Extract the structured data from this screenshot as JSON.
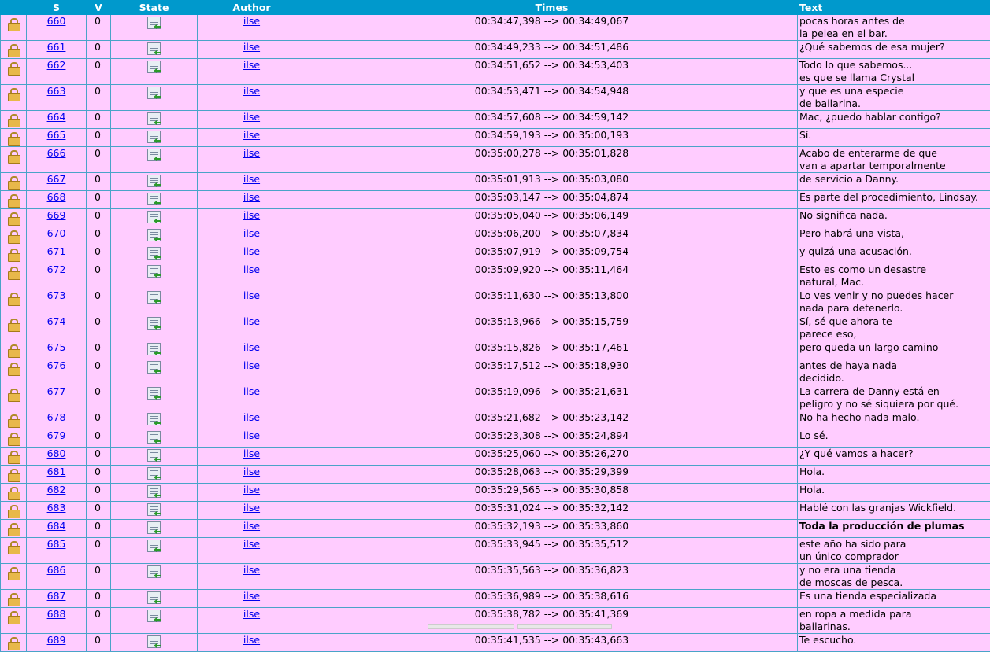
{
  "headers": {
    "s": "S",
    "v": "V",
    "state": "State",
    "author": "Author",
    "times": "Times",
    "text": "Text"
  },
  "icons": {
    "row_lock": "lock-icon",
    "row_state": "state-icon"
  },
  "colors": {
    "header_bg": "#0099cc",
    "row_bg": "#ffccff",
    "link": "#0000ee"
  },
  "rows": [
    {
      "s": "660",
      "v": "0",
      "author": "ilse",
      "times": "00:34:47,398 --> 00:34:49,067",
      "text": "pocas horas antes de\nla pelea en el bar."
    },
    {
      "s": "661",
      "v": "0",
      "author": "ilse",
      "times": "00:34:49,233 --> 00:34:51,486",
      "text": "¿Qué sabemos de esa mujer?"
    },
    {
      "s": "662",
      "v": "0",
      "author": "ilse",
      "times": "00:34:51,652 --> 00:34:53,403",
      "text": "Todo lo que sabemos...\nes que se llama Crystal"
    },
    {
      "s": "663",
      "v": "0",
      "author": "ilse",
      "times": "00:34:53,471 --> 00:34:54,948",
      "text": "y que es una especie\nde bailarina."
    },
    {
      "s": "664",
      "v": "0",
      "author": "ilse",
      "times": "00:34:57,608 --> 00:34:59,142",
      "text": "Mac, ¿puedo hablar contigo?"
    },
    {
      "s": "665",
      "v": "0",
      "author": "ilse",
      "times": "00:34:59,193 --> 00:35:00,193",
      "text": "Sí."
    },
    {
      "s": "666",
      "v": "0",
      "author": "ilse",
      "times": "00:35:00,278 --> 00:35:01,828",
      "text": "Acabo de enterarme de que\nvan a apartar temporalmente"
    },
    {
      "s": "667",
      "v": "0",
      "author": "ilse",
      "times": "00:35:01,913 --> 00:35:03,080",
      "text": "de servicio a Danny."
    },
    {
      "s": "668",
      "v": "0",
      "author": "ilse",
      "times": "00:35:03,147 --> 00:35:04,874",
      "text": "Es parte del procedimiento, Lindsay."
    },
    {
      "s": "669",
      "v": "0",
      "author": "ilse",
      "times": "00:35:05,040 --> 00:35:06,149",
      "text": "No significa nada."
    },
    {
      "s": "670",
      "v": "0",
      "author": "ilse",
      "times": "00:35:06,200 --> 00:35:07,834",
      "text": "Pero habrá una vista,"
    },
    {
      "s": "671",
      "v": "0",
      "author": "ilse",
      "times": "00:35:07,919 --> 00:35:09,754",
      "text": "y quizá una acusación."
    },
    {
      "s": "672",
      "v": "0",
      "author": "ilse",
      "times": "00:35:09,920 --> 00:35:11,464",
      "text": "Esto es como un desastre\nnatural, Mac."
    },
    {
      "s": "673",
      "v": "0",
      "author": "ilse",
      "times": "00:35:11,630 --> 00:35:13,800",
      "text": "Lo ves venir y no puedes hacer\nnada para detenerlo."
    },
    {
      "s": "674",
      "v": "0",
      "author": "ilse",
      "times": "00:35:13,966 --> 00:35:15,759",
      "text": "Sí, sé que ahora te\nparece eso,"
    },
    {
      "s": "675",
      "v": "0",
      "author": "ilse",
      "times": "00:35:15,826 --> 00:35:17,461",
      "text": "pero queda un largo camino"
    },
    {
      "s": "676",
      "v": "0",
      "author": "ilse",
      "times": "00:35:17,512 --> 00:35:18,930",
      "text": "antes de haya nada\ndecidido."
    },
    {
      "s": "677",
      "v": "0",
      "author": "ilse",
      "times": "00:35:19,096 --> 00:35:21,631",
      "text": "La carrera de Danny está en\npeligro y no sé siquiera por qué."
    },
    {
      "s": "678",
      "v": "0",
      "author": "ilse",
      "times": "00:35:21,682 --> 00:35:23,142",
      "text": "No ha hecho nada malo."
    },
    {
      "s": "679",
      "v": "0",
      "author": "ilse",
      "times": "00:35:23,308 --> 00:35:24,894",
      "text": "Lo sé."
    },
    {
      "s": "680",
      "v": "0",
      "author": "ilse",
      "times": "00:35:25,060 --> 00:35:26,270",
      "text": "¿Y qué vamos a hacer?"
    },
    {
      "s": "681",
      "v": "0",
      "author": "ilse",
      "times": "00:35:28,063 --> 00:35:29,399",
      "text": "Hola."
    },
    {
      "s": "682",
      "v": "0",
      "author": "ilse",
      "times": "00:35:29,565 --> 00:35:30,858",
      "text": "Hola."
    },
    {
      "s": "683",
      "v": "0",
      "author": "ilse",
      "times": "00:35:31,024 --> 00:35:32,142",
      "text": "Hablé con las granjas Wickfield."
    },
    {
      "s": "684",
      "v": "0",
      "author": "ilse",
      "times": "00:35:32,193 --> 00:35:33,860",
      "text": "Toda la producción de plumas",
      "bold": true
    },
    {
      "s": "685",
      "v": "0",
      "author": "ilse",
      "times": "00:35:33,945 --> 00:35:35,512",
      "text": "este año ha sido para\nun único comprador"
    },
    {
      "s": "686",
      "v": "0",
      "author": "ilse",
      "times": "00:35:35,563 --> 00:35:36,823",
      "text": "y no era una tienda\nde moscas de pesca."
    },
    {
      "s": "687",
      "v": "0",
      "author": "ilse",
      "times": "00:35:36,989 --> 00:35:38,616",
      "text": "Es una tienda especializada"
    },
    {
      "s": "688",
      "v": "0",
      "author": "ilse",
      "times": "00:35:38,782 --> 00:35:41,369",
      "text": "en ropa a medida para\nbailarinas."
    },
    {
      "s": "689",
      "v": "0",
      "author": "ilse",
      "times": "00:35:41,535 --> 00:35:43,663",
      "text": "Te escucho."
    }
  ]
}
